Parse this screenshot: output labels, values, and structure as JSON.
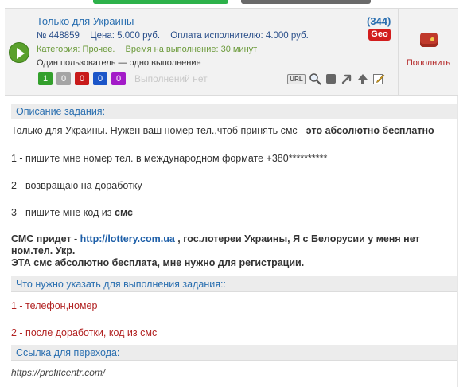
{
  "task": {
    "title": "Только для Украины",
    "count": "(344)",
    "geo_badge": "Geo",
    "number": "№ 448859",
    "price": "Цена: 5.000 руб.",
    "payout": "Оплата исполнителю: 4.000 руб.",
    "category": "Категория: Прочее.",
    "exec_time": "Время на выполнение: 30 минут",
    "rule": "Один пользователь — одно выполнение",
    "counters": [
      {
        "value": "1",
        "color": "#33a02c"
      },
      {
        "value": "0",
        "color": "#a5a5a5"
      },
      {
        "value": "0",
        "color": "#c81b1b"
      },
      {
        "value": "0",
        "color": "#1b55c8"
      },
      {
        "value": "0",
        "color": "#a31bc8"
      }
    ],
    "no_executions": "Выполнений нет",
    "url_tool": "URL",
    "tool_icons": [
      "url-icon",
      "magnifier-icon",
      "stop-icon",
      "forward-arrow-icon",
      "up-arrow-icon",
      "edit-icon"
    ]
  },
  "topup": {
    "label": "Пополнить",
    "icon": "wallet-icon"
  },
  "description": {
    "header": "Описание задания:",
    "line1_plain": "Только для Украины. Нужен ваш номер тел.,чтоб принять смс - ",
    "line1_bold": "это абсолютно бесплатно",
    "step1": "1 - пишите мне номер тел. в международном формате +380**********",
    "step2": "2 - возвращаю на доработку",
    "step3_plain": "3 - пишите мне код из ",
    "step3_bold": "смс",
    "sms_prefix": "СМС придет - ",
    "sms_link": "http://lottery.com.ua",
    "sms_suffix": " , гос.лотереи Украины, Я с Белорусии у меня нет",
    "sms_line2": "ном.тел. Укр.",
    "sms_line3": "ЭТА смс абсолютно бесплата, мне нужно для регистрации."
  },
  "requirements": {
    "header": "Что нужно указать для выполнения задания::",
    "item1": "1 - телефон,номер",
    "item2": "2 - после доработки, код из смс"
  },
  "link_section": {
    "header": "Ссылка для перехода:",
    "url": "https://profitcentr.com/"
  }
}
